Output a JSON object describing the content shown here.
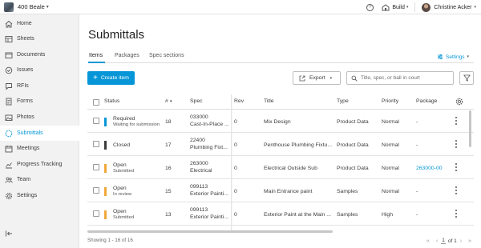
{
  "header": {
    "project_name": "400 Beale",
    "module_label": "Build",
    "user_name": "Christine Acker"
  },
  "sidebar": {
    "items": [
      {
        "label": "Home",
        "icon": "home-icon"
      },
      {
        "label": "Sheets",
        "icon": "sheets-icon"
      },
      {
        "label": "Documents",
        "icon": "documents-icon"
      },
      {
        "label": "Issues",
        "icon": "issues-icon"
      },
      {
        "label": "RFIs",
        "icon": "rfis-icon"
      },
      {
        "label": "Forms",
        "icon": "forms-icon"
      },
      {
        "label": "Photos",
        "icon": "photos-icon"
      },
      {
        "label": "Submittals",
        "icon": "submittals-icon",
        "active": true
      },
      {
        "label": "Meetings",
        "icon": "meetings-icon"
      },
      {
        "label": "Progress Tracking",
        "icon": "progress-icon"
      },
      {
        "label": "Team",
        "icon": "team-icon"
      },
      {
        "label": "Settings",
        "icon": "settings-icon"
      }
    ]
  },
  "page": {
    "title": "Submittals",
    "tabs": [
      {
        "label": "Items",
        "active": true
      },
      {
        "label": "Packages"
      },
      {
        "label": "Spec sections"
      }
    ],
    "settings_label": "Settings"
  },
  "toolbar": {
    "create_label": "Create item",
    "export_label": "Export",
    "search_placeholder": "Title, spec, or ball in court"
  },
  "table": {
    "columns": [
      "Status",
      "#",
      "Spec",
      "Rev",
      "Title",
      "Type",
      "Priority",
      "Package"
    ],
    "rows": [
      {
        "status": "Required",
        "status_sub": "Waiting for submission",
        "status_color": "#0696d7",
        "num": "18",
        "spec_code": "033000",
        "spec_name": "Cast-In-Place ...",
        "rev": "0",
        "title": "Mix Design",
        "type": "Product Data",
        "priority": "Normal",
        "package": "-",
        "package_link": false
      },
      {
        "status": "Closed",
        "status_sub": "",
        "status_color": "#3c3c3c",
        "num": "17",
        "spec_code": "22400",
        "spec_name": "Plumbing Fixt...",
        "rev": "0",
        "title": "Penthouse Plumbing Fixtu...",
        "type": "Product Data",
        "priority": "Normal",
        "package": "-",
        "package_link": false
      },
      {
        "status": "Open",
        "status_sub": "Submitted",
        "status_color": "#f2a73b",
        "num": "16",
        "spec_code": "263000",
        "spec_name": "Electrical",
        "rev": "0",
        "title": "Electrical Outside Sub",
        "type": "Product Data",
        "priority": "Normal",
        "package": "263000-00",
        "package_link": true
      },
      {
        "status": "Open",
        "status_sub": "In review",
        "status_color": "#f2a73b",
        "num": "15",
        "spec_code": "099113",
        "spec_name": "Exterior Painti...",
        "rev": "0",
        "title": "Main Entrance paint",
        "type": "Samples",
        "priority": "Normal",
        "package": "-",
        "package_link": false
      },
      {
        "status": "Open",
        "status_sub": "Submitted",
        "status_color": "#f2a73b",
        "num": "13",
        "spec_code": "099113",
        "spec_name": "Exterior Painti...",
        "rev": "0",
        "title": "Exterior Paint at the Main ...",
        "type": "Samples",
        "priority": "High",
        "package": "-",
        "package_link": false
      }
    ]
  },
  "footer": {
    "showing_text": "Showing 1 - 16 of 16",
    "page_current": "1",
    "page_of": "of 1"
  },
  "colors": {
    "accent": "#0696d7",
    "open_status": "#f2a73b",
    "closed_status": "#3c3c3c"
  }
}
